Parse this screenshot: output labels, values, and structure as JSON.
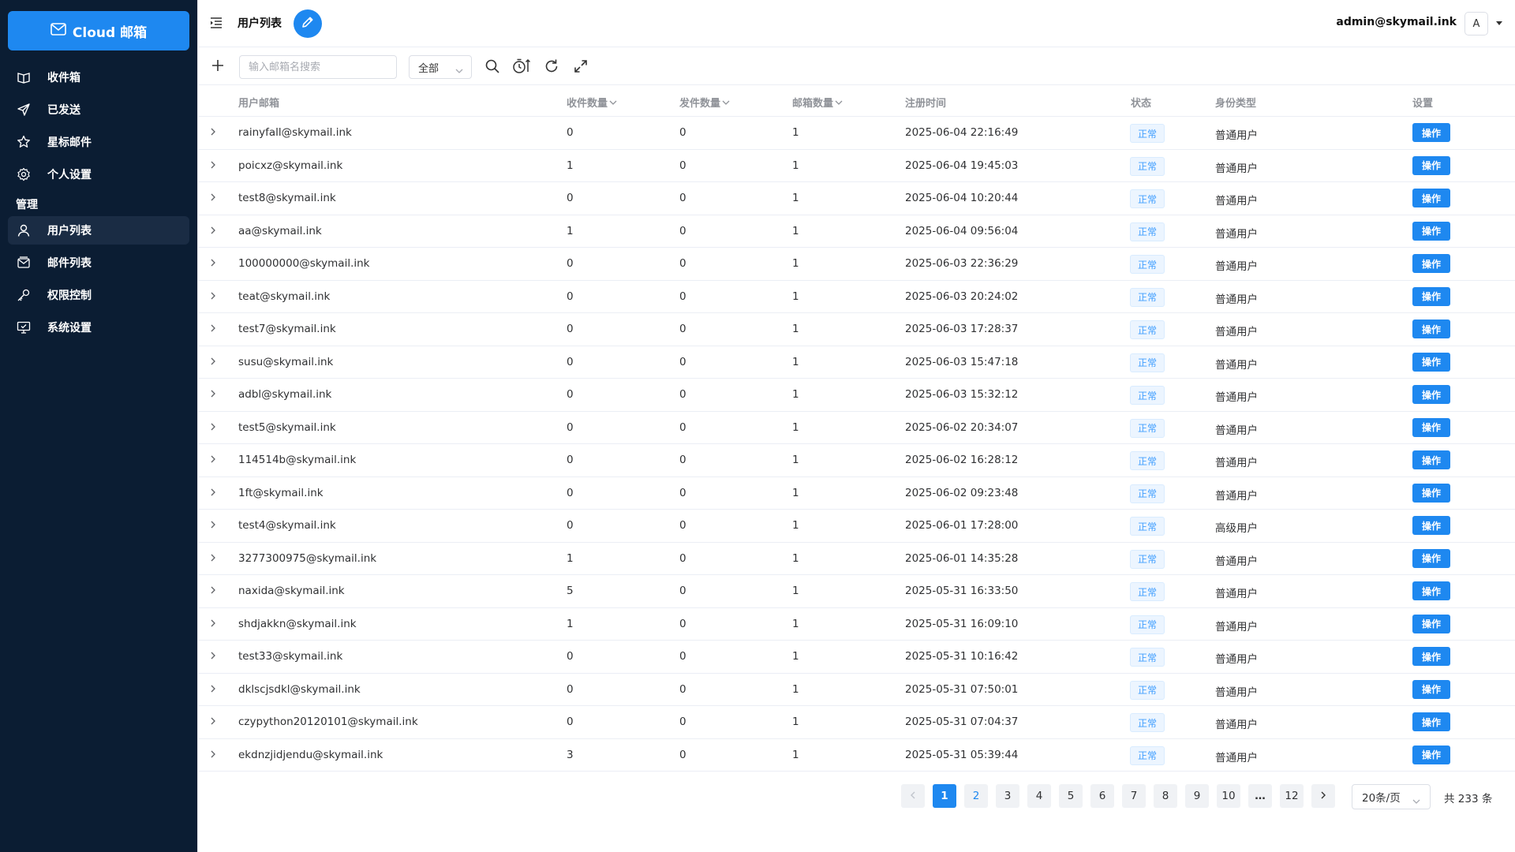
{
  "brand": {
    "label": "Cloud 邮箱"
  },
  "sidebar": {
    "items": [
      {
        "label": "收件箱",
        "icon": "inbox-icon"
      },
      {
        "label": "已发送",
        "icon": "send-icon"
      },
      {
        "label": "星标邮件",
        "icon": "star-icon"
      },
      {
        "label": "个人设置",
        "icon": "gear-icon"
      }
    ],
    "section_label": "管理",
    "admin_items": [
      {
        "label": "用户列表",
        "icon": "user-icon",
        "active": true
      },
      {
        "label": "邮件列表",
        "icon": "mail-list-icon"
      },
      {
        "label": "权限控制",
        "icon": "key-icon"
      },
      {
        "label": "系统设置",
        "icon": "monitor-settings-icon"
      }
    ]
  },
  "header": {
    "title": "用户列表",
    "account_email": "admin@skymail.ink",
    "avatar_letter": "A"
  },
  "toolbar": {
    "search_placeholder": "输入邮箱名搜索",
    "filter_value": "全部"
  },
  "table": {
    "columns": {
      "email": "用户邮箱",
      "received": "收件数量",
      "sent": "发件数量",
      "mailboxes": "邮箱数量",
      "registered": "注册时间",
      "status": "状态",
      "role": "身份类型",
      "settings": "设置"
    },
    "status_label": "正常",
    "action_label": "操作",
    "rows": [
      {
        "email": "rainyfall@skymail.ink",
        "received": "0",
        "sent": "0",
        "mailboxes": "1",
        "registered": "2025-06-04 22:16:49",
        "role": "普通用户"
      },
      {
        "email": "poicxz@skymail.ink",
        "received": "1",
        "sent": "0",
        "mailboxes": "1",
        "registered": "2025-06-04 19:45:03",
        "role": "普通用户"
      },
      {
        "email": "test8@skymail.ink",
        "received": "0",
        "sent": "0",
        "mailboxes": "1",
        "registered": "2025-06-04 10:20:44",
        "role": "普通用户"
      },
      {
        "email": "aa@skymail.ink",
        "received": "1",
        "sent": "0",
        "mailboxes": "1",
        "registered": "2025-06-04 09:56:04",
        "role": "普通用户"
      },
      {
        "email": "100000000@skymail.ink",
        "received": "0",
        "sent": "0",
        "mailboxes": "1",
        "registered": "2025-06-03 22:36:29",
        "role": "普通用户"
      },
      {
        "email": "teat@skymail.ink",
        "received": "0",
        "sent": "0",
        "mailboxes": "1",
        "registered": "2025-06-03 20:24:02",
        "role": "普通用户"
      },
      {
        "email": "test7@skymail.ink",
        "received": "0",
        "sent": "0",
        "mailboxes": "1",
        "registered": "2025-06-03 17:28:37",
        "role": "普通用户"
      },
      {
        "email": "susu@skymail.ink",
        "received": "0",
        "sent": "0",
        "mailboxes": "1",
        "registered": "2025-06-03 15:47:18",
        "role": "普通用户"
      },
      {
        "email": "adbl@skymail.ink",
        "received": "0",
        "sent": "0",
        "mailboxes": "1",
        "registered": "2025-06-03 15:32:12",
        "role": "普通用户"
      },
      {
        "email": "test5@skymail.ink",
        "received": "0",
        "sent": "0",
        "mailboxes": "1",
        "registered": "2025-06-02 20:34:07",
        "role": "普通用户"
      },
      {
        "email": "114514b@skymail.ink",
        "received": "0",
        "sent": "0",
        "mailboxes": "1",
        "registered": "2025-06-02 16:28:12",
        "role": "普通用户"
      },
      {
        "email": "1ft@skymail.ink",
        "received": "0",
        "sent": "0",
        "mailboxes": "1",
        "registered": "2025-06-02 09:23:48",
        "role": "普通用户"
      },
      {
        "email": "test4@skymail.ink",
        "received": "0",
        "sent": "0",
        "mailboxes": "1",
        "registered": "2025-06-01 17:28:00",
        "role": "高级用户"
      },
      {
        "email": "3277300975@skymail.ink",
        "received": "1",
        "sent": "0",
        "mailboxes": "1",
        "registered": "2025-06-01 14:35:28",
        "role": "普通用户"
      },
      {
        "email": "naxida@skymail.ink",
        "received": "5",
        "sent": "0",
        "mailboxes": "1",
        "registered": "2025-05-31 16:33:50",
        "role": "普通用户"
      },
      {
        "email": "shdjakkn@skymail.ink",
        "received": "1",
        "sent": "0",
        "mailboxes": "1",
        "registered": "2025-05-31 16:09:10",
        "role": "普通用户"
      },
      {
        "email": "test33@skymail.ink",
        "received": "0",
        "sent": "0",
        "mailboxes": "1",
        "registered": "2025-05-31 10:16:42",
        "role": "普通用户"
      },
      {
        "email": "dklscjsdkl@skymail.ink",
        "received": "0",
        "sent": "0",
        "mailboxes": "1",
        "registered": "2025-05-31 07:50:01",
        "role": "普通用户"
      },
      {
        "email": "czypython20120101@skymail.ink",
        "received": "0",
        "sent": "0",
        "mailboxes": "1",
        "registered": "2025-05-31 07:04:37",
        "role": "普通用户"
      },
      {
        "email": "ekdnzjidjendu@skymail.ink",
        "received": "3",
        "sent": "0",
        "mailboxes": "1",
        "registered": "2025-05-31 05:39:44",
        "role": "普通用户"
      }
    ]
  },
  "pagination": {
    "current": "1",
    "pages": [
      "1",
      "2",
      "3",
      "4",
      "5",
      "6",
      "7",
      "8",
      "9",
      "10",
      "…",
      "12"
    ],
    "page_size": "20条/页",
    "total": "共 233 条"
  },
  "colors": {
    "sidebar": "#0b1d33",
    "accent": "#1e88f0",
    "tag_bg": "#ecf5ff",
    "tag_text": "#409eff"
  }
}
